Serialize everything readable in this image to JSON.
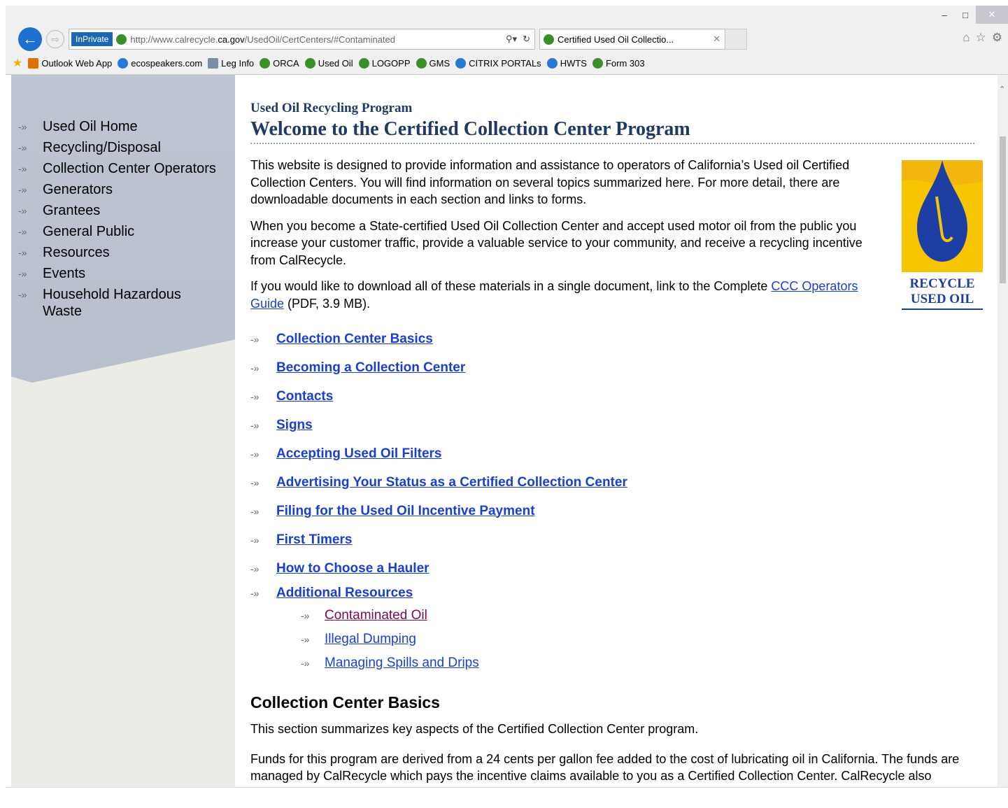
{
  "browser": {
    "inprivate": "InPrivate",
    "url_prefix": "http://www.calrecycle.",
    "url_domain": "ca.gov",
    "url_suffix": "/UsedOil/CertCenters/#Contaminated",
    "tab_title": "Certified Used Oil Collectio...",
    "favorites": [
      "Outlook Web App",
      "ecospeakers.com",
      "Leg Info",
      "ORCA",
      "Used Oil",
      "LOGOPP",
      "GMS",
      "CITRIX PORTALs",
      "HWTS",
      "Form 303"
    ]
  },
  "sidebar": {
    "items": [
      "Used Oil Home",
      "Recycling/Disposal",
      "Collection Center Operators",
      "Generators",
      "Grantees",
      "General Public",
      "Resources",
      "Events",
      "Household Hazardous Waste"
    ]
  },
  "main": {
    "program": "Used Oil Recycling Program",
    "title": "Welcome to the Certified Collection Center Program",
    "p1": "This website is designed to provide information and assistance to operators of California’s Used oil Certified Collection Centers. You will find information on several topics summarized here. For more detail, there are downloadable documents in each section and links to forms.",
    "p2": "When you become a State-certified Used Oil Collection Center and accept used motor oil from the public you increase your customer traffic, provide a valuable service to your community, and receive a recycling incentive from CalRecycle.",
    "p3_before": "If you would like to download all of these materials in a single document, link to the Complete ",
    "p3_link": "CCC Operators Guide",
    "p3_after": " (PDF, 3.9 MB).",
    "logo_line1": "RECYCLE",
    "logo_line2": "USED OIL",
    "links": [
      "Collection Center Basics",
      "Becoming a Collection Center",
      "Contacts",
      "Signs",
      "Accepting Used Oil Filters",
      "Advertising Your Status as a Certified Collection Center",
      "Filing for the Used Oil Incentive Payment",
      "First Timers",
      "How to Choose a Hauler",
      "Additional Resources"
    ],
    "sublinks": [
      "Contaminated Oil",
      "Illegal Dumping",
      "Managing Spills and Drips"
    ],
    "section_title": "Collection Center Basics",
    "section_p1": "This section summarizes key aspects of the Certified Collection Center program.",
    "section_p2": "Funds for this program are derived from a 24 cents per gallon fee added to the cost of lubricating oil in California. The funds are managed by CalRecycle which pays the incentive claims available to you as a Certified Collection Center. CalRecycle also distributes money to local city/county Used Oil Recycling Programs through the Oil"
  },
  "colors": {
    "link": "#1a3fd0",
    "visited": "#7a0a5a",
    "heading": "#1f3a63",
    "sidebar_panel": "#bfc4d2",
    "logo_yellow": "#f2b60f",
    "logo_blue": "#1d3fa3"
  }
}
